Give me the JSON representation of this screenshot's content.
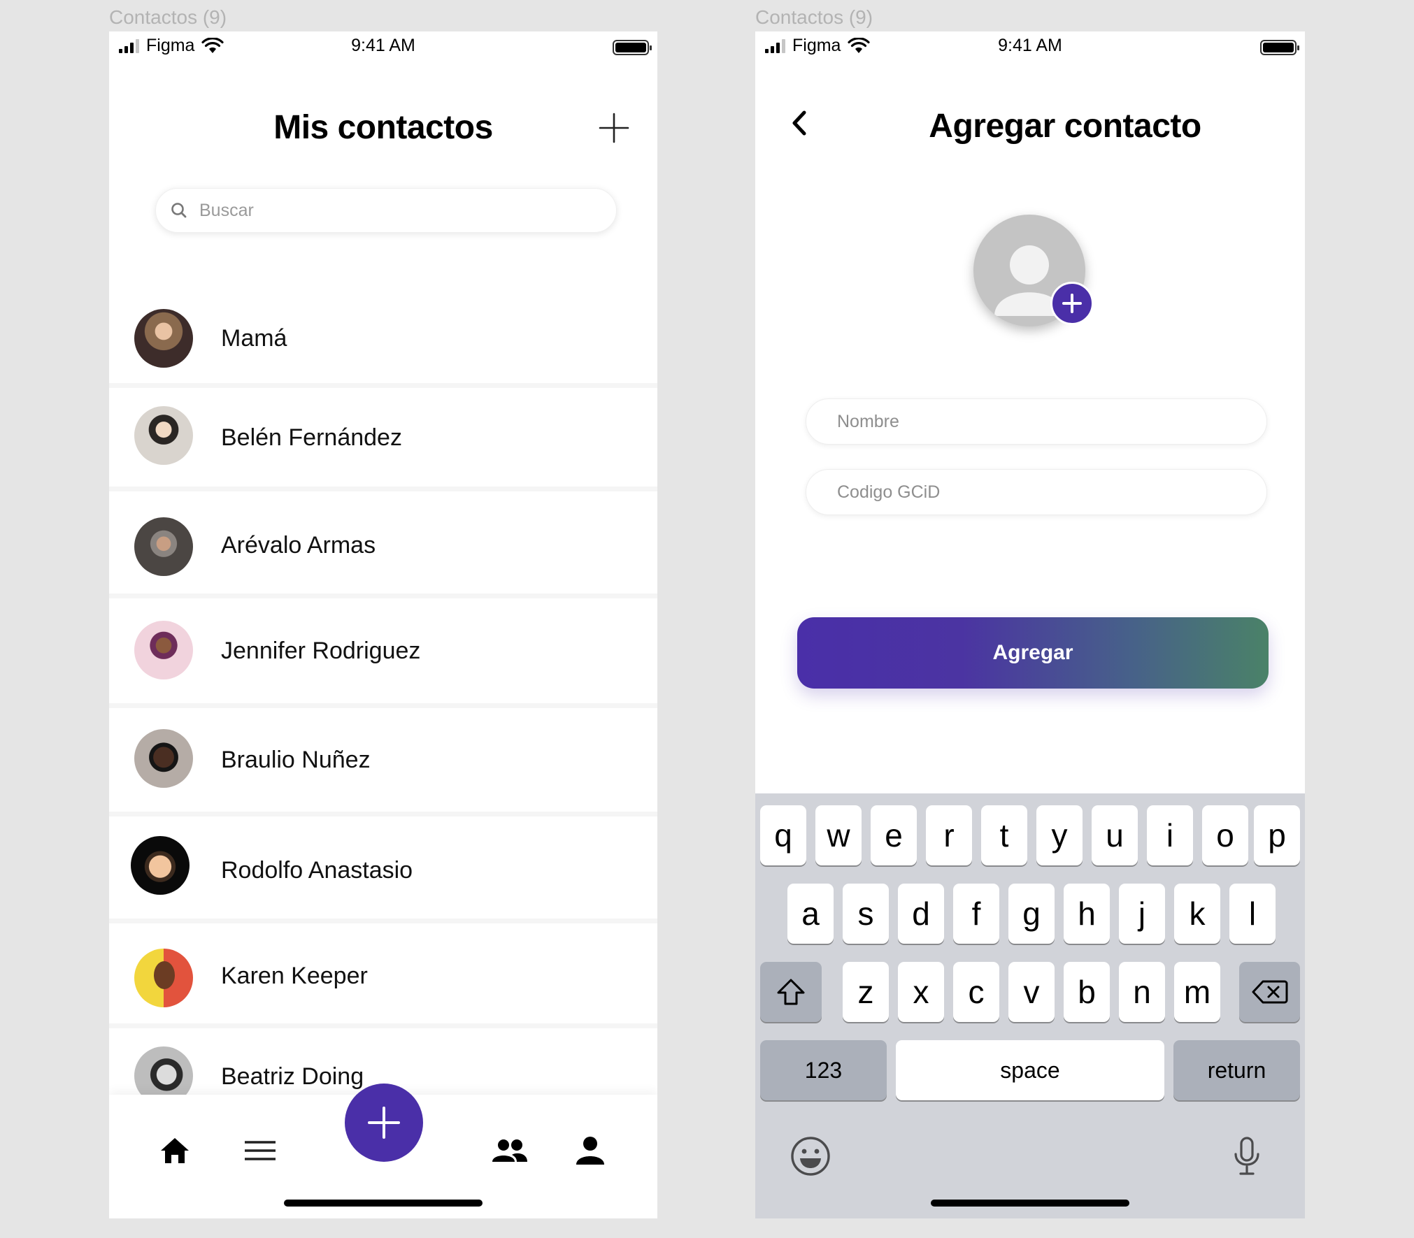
{
  "frames": [
    {
      "label": "Contactos (9)"
    },
    {
      "label": "Contactos (9)"
    }
  ],
  "status_bar": {
    "carrier": "Figma",
    "time": "9:41 AM"
  },
  "contacts_screen": {
    "title": "Mis contactos",
    "search_placeholder": "Buscar",
    "contacts": [
      {
        "name": "Mamá",
        "avatar_color": "#6b4a3a"
      },
      {
        "name": "Belén Fernández",
        "avatar_color": "#b9b4ae"
      },
      {
        "name": "Arévalo Armas",
        "avatar_color": "#5e5a55"
      },
      {
        "name": "Jennifer Rodriguez",
        "avatar_color": "#e9c9d3"
      },
      {
        "name": "Braulio Nuñez",
        "avatar_color": "#3a3330"
      },
      {
        "name": "Rodolfo Anastasio",
        "avatar_color": "#111111"
      },
      {
        "name": "Karen Keeper",
        "avatar_color": "#e8c93a"
      },
      {
        "name": "Beatriz Doing",
        "avatar_color": "#8a8a8a"
      }
    ],
    "bottom_nav": [
      "home-icon",
      "menu-icon",
      "plus-icon",
      "people-icon",
      "person-icon"
    ]
  },
  "add_screen": {
    "title": "Agregar contacto",
    "name_placeholder": "Nombre",
    "code_placeholder": "Codigo GCiD",
    "button_label": "Agregar",
    "accent_color": "#4a2fa8"
  },
  "keyboard": {
    "row1": [
      "q",
      "w",
      "e",
      "r",
      "t",
      "y",
      "u",
      "i",
      "o",
      "p"
    ],
    "row2": [
      "a",
      "s",
      "d",
      "f",
      "g",
      "h",
      "j",
      "k",
      "l"
    ],
    "row3": [
      "z",
      "x",
      "c",
      "v",
      "b",
      "n",
      "m"
    ],
    "numbers_label": "123",
    "space_label": "space",
    "return_label": "return"
  }
}
